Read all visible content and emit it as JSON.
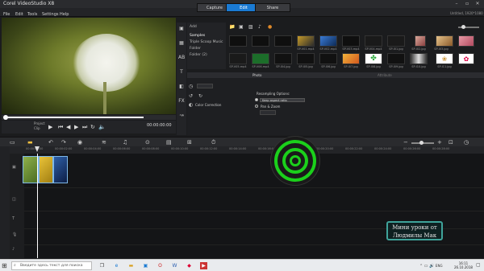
{
  "app": {
    "title": "Corel VideoStudio X8"
  },
  "menu": {
    "items": [
      "File",
      "Edit",
      "Tools",
      "Settings",
      "Help"
    ]
  },
  "tabs": [
    "Capture",
    "Edit",
    "Share"
  ],
  "title_right": "Untitled, 1920*1080",
  "preview": {
    "transport_labels": [
      "Project",
      "Clip"
    ],
    "timecode": "00:00:00:00"
  },
  "library": {
    "nav": {
      "add": "Add",
      "items": [
        "Samples",
        "Triple Scoop Music",
        "Folder",
        "Folder (2)"
      ]
    },
    "browse": "Browse",
    "thumbs_row1": [
      "",
      "",
      "",
      "SP-V01.mp4",
      "SP-V02.mp4",
      "SP-V03.mp4",
      "SP-V04.mp4",
      "SP-I01.jpg",
      "SP-I02.jpg",
      "SP-I03.jpg"
    ],
    "thumbs_row2": [
      "SP-V05.mp4",
      "SP-V06.mp4",
      "SP-I04.jpg",
      "SP-I05.jpg",
      "SP-I06.jpg",
      "SP-I07.jpg",
      "SP-I08.jpg",
      "SP-I09.jpg",
      "SP-I10.jpg",
      "SP-I11.jpg"
    ]
  },
  "options": {
    "tab_photo": "Photo",
    "tab_attribute": "Attribute",
    "color_correction": "Color Correction",
    "resampling_label": "Resampling Options:",
    "resampling_value": "Keep aspect ratio",
    "pan_zoom": "Pan & Zoom",
    "duration": "0:00:03:00"
  },
  "timeline": {
    "ruler": [
      "00:00:00:00",
      "00:00:02:00",
      "00:00:04:00",
      "00:00:06:00",
      "00:00:08:00",
      "00:00:10:00",
      "00:00:12:00",
      "00:00:14:00",
      "00:00:16:00",
      "00:00:18:00",
      "00:00:20:00",
      "00:00:22:00",
      "00:00:24:00",
      "00:00:26:00",
      "00:00:28:00"
    ]
  },
  "watermark": {
    "line1": "Мини уроки от",
    "line2": "Людмилы Мак"
  },
  "taskbar": {
    "search_placeholder": "Введите здесь текст для поиска",
    "time": "16:11",
    "date": "26.10.2018",
    "lang": "ENG"
  },
  "colors": {
    "accent": "#1a7ad3",
    "indicator": "#1bd01b",
    "watermark_border": "#3fa39a"
  }
}
